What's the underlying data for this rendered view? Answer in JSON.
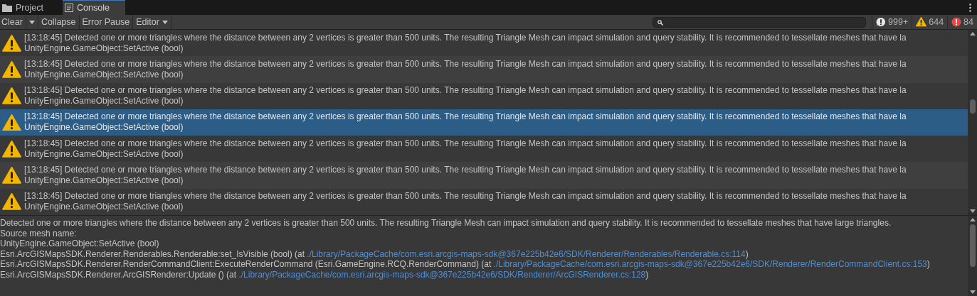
{
  "tabs": [
    {
      "label": "Project",
      "kind": "folder",
      "selected": false
    },
    {
      "label": "Console",
      "kind": "list",
      "selected": true
    }
  ],
  "toolbar": {
    "buttons": [
      {
        "label": "Clear",
        "kind": "split",
        "selected": false
      },
      {
        "label": "Collapse",
        "kind": "toggle",
        "selected": false
      },
      {
        "label": "Error Pause",
        "kind": "toggle",
        "selected": false
      },
      {
        "label": "Editor",
        "kind": "dropdown",
        "selected": false
      }
    ],
    "counters": [
      {
        "kind": "info",
        "count": "999+"
      },
      {
        "kind": "warning",
        "count": "644"
      },
      {
        "kind": "error",
        "count": "84"
      }
    ]
  },
  "log": [
    {
      "message": "[13:18:45] Detected one or more triangles where the distance between any 2 vertices is greater than 500 units. The resulting Triangle Mesh can impact simulation and query stability. It is recommended to tessellate meshes that have la",
      "source": "UnityEngine.GameObject:SetActive (bool)",
      "selected": false
    },
    {
      "message": "[13:18:45] Detected one or more triangles where the distance between any 2 vertices is greater than 500 units. The resulting Triangle Mesh can impact simulation and query stability. It is recommended to tessellate meshes that have la",
      "source": "UnityEngine.GameObject:SetActive (bool)",
      "selected": false
    },
    {
      "message": "[13:18:45] Detected one or more triangles where the distance between any 2 vertices is greater than 500 units. The resulting Triangle Mesh can impact simulation and query stability. It is recommended to tessellate meshes that have la",
      "source": "UnityEngine.GameObject:SetActive (bool)",
      "selected": false
    },
    {
      "message": "[13:18:45] Detected one or more triangles where the distance between any 2 vertices is greater than 500 units. The resulting Triangle Mesh can impact simulation and query stability. It is recommended to tessellate meshes that have la",
      "source": "UnityEngine.GameObject:SetActive (bool)",
      "selected": true
    },
    {
      "message": "[13:18:45] Detected one or more triangles where the distance between any 2 vertices is greater than 500 units. The resulting Triangle Mesh can impact simulation and query stability. It is recommended to tessellate meshes that have la",
      "source": "UnityEngine.GameObject:SetActive (bool)",
      "selected": false
    },
    {
      "message": "[13:18:45] Detected one or more triangles where the distance between any 2 vertices is greater than 500 units. The resulting Triangle Mesh can impact simulation and query stability. It is recommended to tessellate meshes that have la",
      "source": "UnityEngine.GameObject:SetActive (bool)",
      "selected": false
    },
    {
      "message": "[13:18:45] Detected one or more triangles where the distance between any 2 vertices is greater than 500 units. The resulting Triangle Mesh can impact simulation and query stability. It is recommended to tessellate meshes that have la",
      "source": "UnityEngine.GameObject:SetActive (bool)",
      "selected": false
    }
  ],
  "detail": [
    {
      "text": "Detected one or more triangles where the distance between any 2 vertices is greater than 500 units. The resulting Triangle Mesh can impact simulation and query stability. It is recommended to tessellate meshes that have large triangles."
    },
    {
      "text": "Source mesh name:"
    },
    {
      "text": "UnityEngine.GameObject:SetActive (bool)"
    },
    {
      "text": "Esri.ArcGISMapsSDK.Renderer.Renderables.Renderable:set_IsVisible (bool) (at ",
      "link": "./Library/PackageCache/com.esri.arcgis-maps-sdk@367e225b42e6/SDK/Renderer/Renderables/Renderable.cs:114",
      "suffix": ")"
    },
    {
      "text": "Esri.ArcGISMapsSDK.Renderer.RenderCommandClient:ExecuteRenderCommand (Esri.GameEngine.RCQ.RenderCommand) (at ",
      "link": "./Library/PackageCache/com.esri.arcgis-maps-sdk@367e225b42e6/SDK/Renderer/RenderCommandClient.cs:153",
      "suffix": ")"
    },
    {
      "text": "Esri.ArcGISMapsSDK.Renderer.ArcGISRenderer:Update () (at ",
      "link": "./Library/PackageCache/com.esri.arcgis-maps-sdk@367e225b42e6/SDK/Renderer/ArcGISRenderer.cs:128",
      "suffix": ")"
    }
  ]
}
